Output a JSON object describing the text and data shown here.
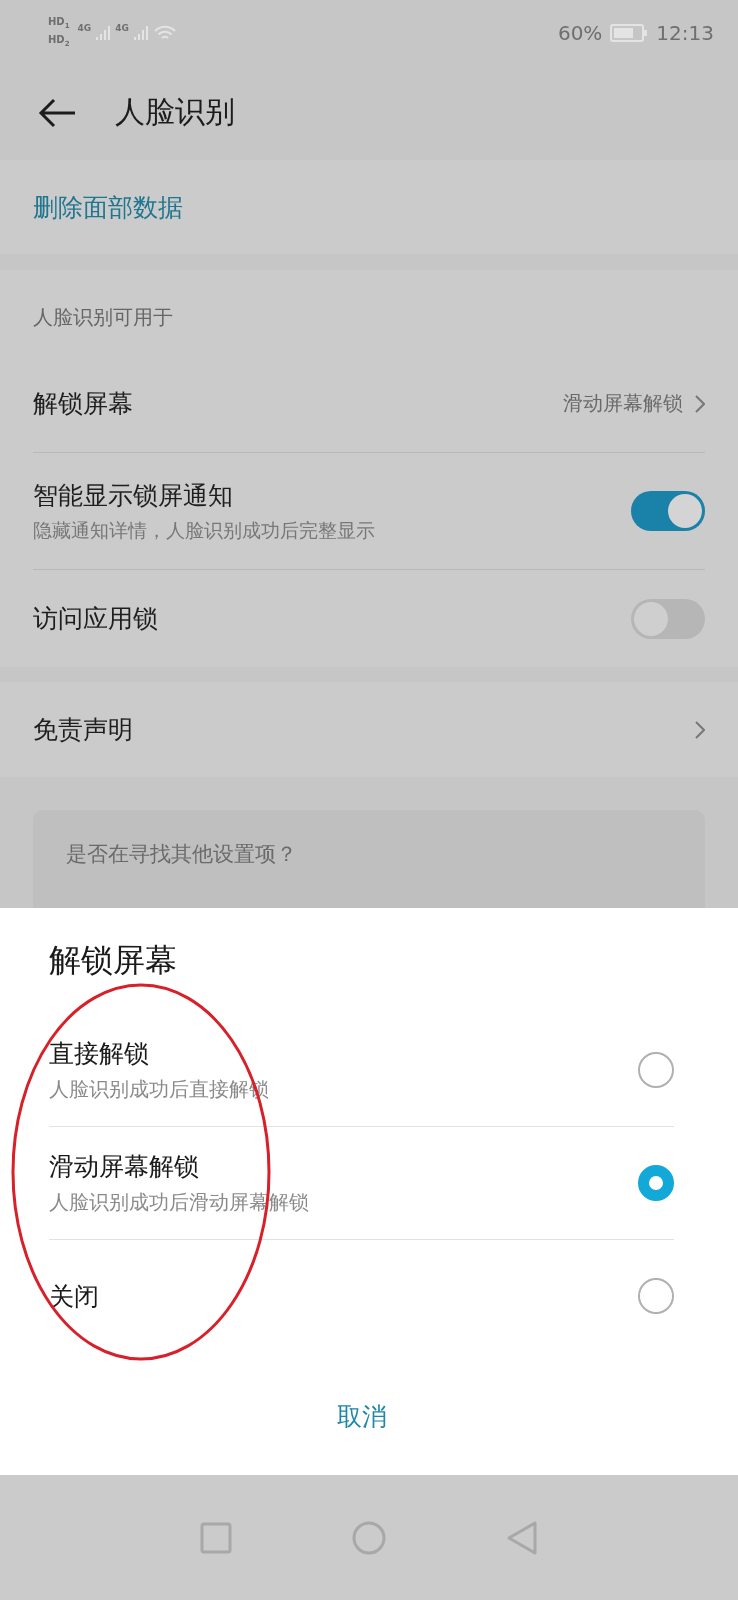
{
  "status_bar": {
    "sims": [
      {
        "hd": "HD",
        "slot": "1",
        "network": "4G"
      },
      {
        "hd": "HD",
        "slot": "2",
        "network": "4G"
      }
    ],
    "battery": "60%",
    "time": "12:13"
  },
  "header": {
    "title": "人脸识别"
  },
  "delete_action": {
    "label": "删除面部数据"
  },
  "section": {
    "title": "人脸识别可用于",
    "items": [
      {
        "kind": "link",
        "title": "解锁屏幕",
        "value": "滑动屏幕解锁"
      },
      {
        "kind": "toggle",
        "title": "智能显示锁屏通知",
        "subtitle": "隐藏通知详情，人脸识别成功后完整显示",
        "on": true
      },
      {
        "kind": "toggle",
        "title": "访问应用锁",
        "on": false
      }
    ]
  },
  "disclaimer": {
    "title": "免责声明"
  },
  "suggestion_card": {
    "text": "是否在寻找其他设置项？"
  },
  "dialog": {
    "title": "解锁屏幕",
    "options": [
      {
        "title": "直接解锁",
        "subtitle": "人脸识别成功后直接解锁",
        "selected": false
      },
      {
        "title": "滑动屏幕解锁",
        "subtitle": "人脸识别成功后滑动屏幕解锁",
        "selected": true
      },
      {
        "title": "关闭",
        "selected": false
      }
    ],
    "cancel": "取消"
  },
  "annotation": {
    "kind": "ellipse",
    "color": "#d8202a"
  }
}
